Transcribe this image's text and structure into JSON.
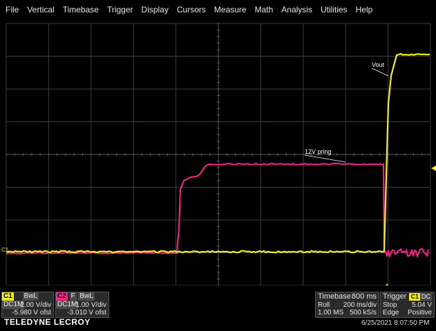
{
  "menu": [
    "File",
    "Vertical",
    "Timebase",
    "Trigger",
    "Display",
    "Cursors",
    "Measure",
    "Math",
    "Analysis",
    "Utilities",
    "Help"
  ],
  "labels": {
    "vout": "Vout",
    "pring": "12V pring",
    "c1_marker": "C1"
  },
  "colors": {
    "ch1": "#f2f21a",
    "ch2": "#ff1f8a",
    "grid": "#444444"
  },
  "ch1": {
    "name": "C1",
    "bw": "BwL",
    "coupling": "DC1M",
    "vdiv": "2.00 V/div",
    "offset": "-5.980 V ofst"
  },
  "ch2": {
    "name": "C2",
    "flag": "F",
    "bw": "BwL",
    "coupling": "DC1M",
    "vdiv": "1.00 V/div",
    "offset": "-3.010 V ofst"
  },
  "timebase": {
    "title": "Timebase",
    "value": "800 ms",
    "mode": "Roll",
    "sdiv": "200 ms/div",
    "pts": "1.00 MS",
    "rate": "500 kS/s"
  },
  "trigger": {
    "title": "Trigger",
    "src": "C1",
    "coupling": "DC",
    "state": "Stop",
    "level": "5.04 V",
    "type": "Edge",
    "slope": "Positive"
  },
  "brand": "TELEDYNE LECROY",
  "timestamp": "6/25/2021 8:07:50 PM"
}
